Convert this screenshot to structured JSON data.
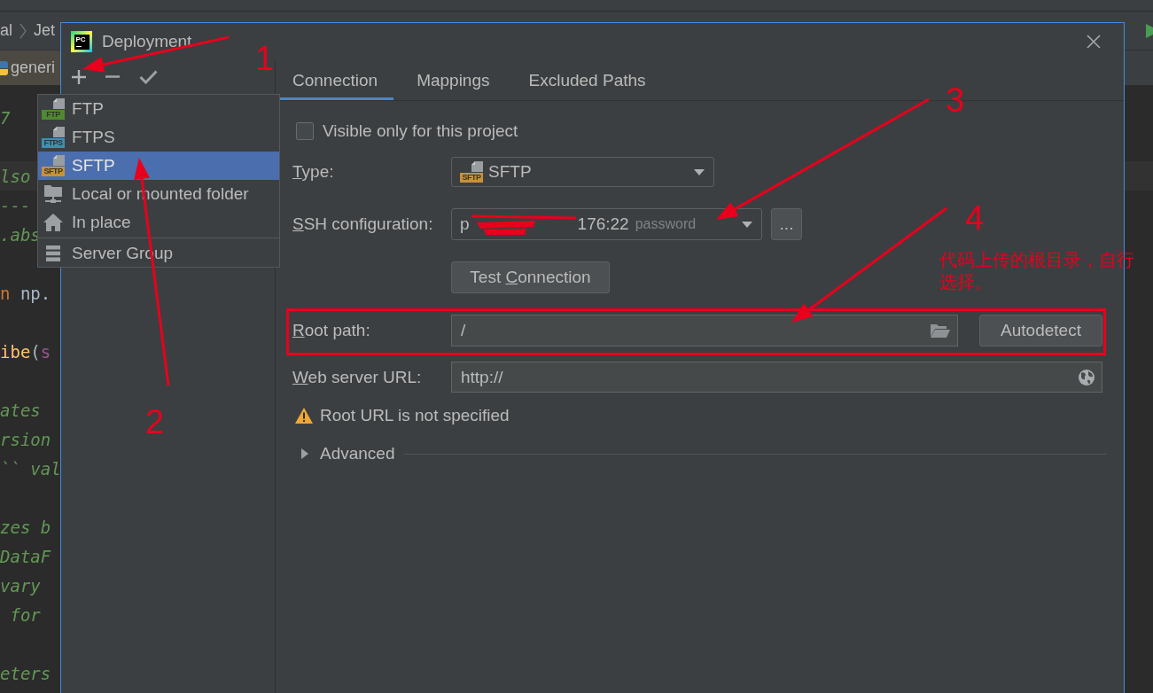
{
  "ide": {
    "breadcrumbs": [
      "al",
      "Jet"
    ],
    "editor_tab": "generi",
    "code_lines": [
      {
        "kind": "code",
        "current": false,
        "segments": [
          {
            "kind": "doc",
            "text": "7"
          }
        ]
      },
      {
        "kind": "blank"
      },
      {
        "kind": "code",
        "current": true,
        "segments": [
          {
            "kind": "doc",
            "text": "lso"
          }
        ]
      },
      {
        "kind": "code",
        "current": false,
        "segments": [
          {
            "kind": "doc",
            "text": "---"
          }
        ]
      },
      {
        "kind": "code",
        "current": false,
        "segments": [
          {
            "kind": "doc",
            "text": ".abs"
          }
        ]
      },
      {
        "kind": "blank"
      },
      {
        "kind": "code",
        "current": false,
        "segments": [
          {
            "kind": "keyword",
            "text": "n"
          },
          {
            "kind": "plain",
            "text": " np."
          }
        ]
      },
      {
        "kind": "blank"
      },
      {
        "kind": "code",
        "current": false,
        "segments": [
          {
            "kind": "function",
            "text": "ibe"
          },
          {
            "kind": "plain",
            "text": "("
          },
          {
            "kind": "self",
            "text": "s"
          }
        ]
      },
      {
        "kind": "blank"
      },
      {
        "kind": "code",
        "current": false,
        "segments": [
          {
            "kind": "doc",
            "text": "ates"
          }
        ]
      },
      {
        "kind": "code",
        "current": false,
        "segments": [
          {
            "kind": "doc",
            "text": "rsion"
          }
        ]
      },
      {
        "kind": "code",
        "current": false,
        "segments": [
          {
            "kind": "doc",
            "text": "`` val"
          }
        ]
      },
      {
        "kind": "blank"
      },
      {
        "kind": "code",
        "current": false,
        "segments": [
          {
            "kind": "doc",
            "text": "zes b"
          }
        ]
      },
      {
        "kind": "code",
        "current": false,
        "segments": [
          {
            "kind": "doc",
            "text": "DataF"
          }
        ]
      },
      {
        "kind": "code",
        "current": false,
        "segments": [
          {
            "kind": "doc",
            "text": "vary"
          }
        ]
      },
      {
        "kind": "code",
        "current": false,
        "segments": [
          {
            "kind": "doc",
            "text": " for"
          }
        ]
      },
      {
        "kind": "blank"
      },
      {
        "kind": "code",
        "current": false,
        "segments": [
          {
            "kind": "doc",
            "text": "eters"
          }
        ]
      }
    ]
  },
  "dialog": {
    "logo": "PC",
    "title": "Deployment",
    "tabs": [
      {
        "label": "Connection",
        "selected": true
      },
      {
        "label": "Mappings",
        "selected": false
      },
      {
        "label": "Excluded Paths",
        "selected": false
      }
    ],
    "visible_only": {
      "label": "Visible only for this project",
      "checked": false
    },
    "type": {
      "label": {
        "key": "T",
        "post": "ype:"
      },
      "badge": "SFTP",
      "value": "SFTP"
    },
    "ssh": {
      "label": {
        "key": "S",
        "post": "SH configuration:"
      },
      "value_start": "p",
      "value_end": "176:22",
      "hint": "password",
      "more_button": "..."
    },
    "test_button": {
      "pre": "Test ",
      "key": "C",
      "post": "onnection"
    },
    "root_path": {
      "label": {
        "key": "R",
        "post": "oot path:"
      },
      "value": "/",
      "autodetect_button": "Autodetect"
    },
    "web_server_url": {
      "label": {
        "key": "W",
        "post": "eb server URL:"
      },
      "value": "http://"
    },
    "warning": "Root URL is not specified",
    "advanced": {
      "label": "Advanced",
      "expanded": false
    }
  },
  "add_menu": {
    "groups": [
      {
        "items": [
          {
            "kind": "protocol",
            "badge": "FTP",
            "color": "#4f8a30",
            "label": "FTP",
            "selected": false
          },
          {
            "kind": "protocol",
            "badge": "FTPS",
            "color": "#3d8fb5",
            "label": "FTPS",
            "selected": false
          },
          {
            "kind": "protocol",
            "badge": "SFTP",
            "color": "#c9913d",
            "label": "SFTP",
            "selected": true
          },
          {
            "kind": "network-folder",
            "label": "Local or mounted folder",
            "selected": false
          },
          {
            "kind": "home",
            "label": "In place",
            "selected": false
          }
        ]
      },
      {
        "items": [
          {
            "kind": "server-group",
            "label": "Server Group",
            "selected": false
          }
        ]
      }
    ]
  },
  "annotations": {
    "numbers": [
      "1",
      "2",
      "3",
      "4"
    ],
    "note": "代码上传的根目录，自行选择。"
  }
}
